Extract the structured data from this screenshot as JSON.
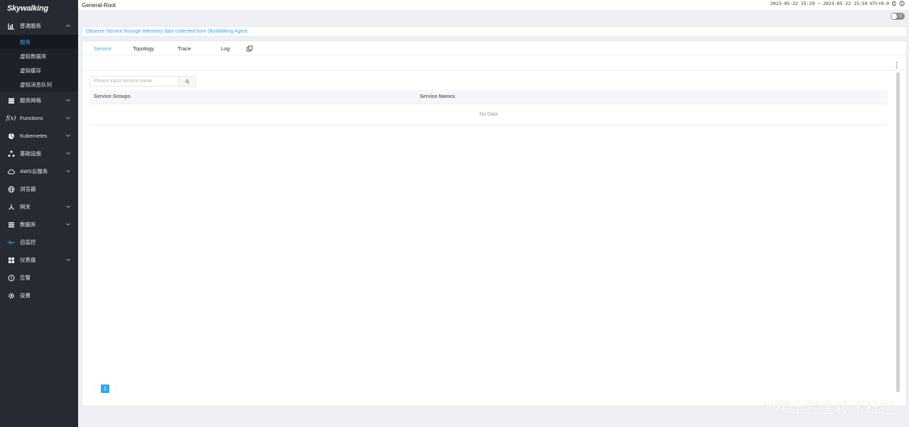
{
  "brand": {
    "logo_text": "Skywalking"
  },
  "colors": {
    "accent": "#3aa5ea",
    "sidebar_bg": "#252a33",
    "content_bg": "#eef0f3"
  },
  "sidebar": {
    "items": [
      {
        "label": "普通服务",
        "icon": "chart-bar-icon",
        "expanded": true,
        "children": [
          {
            "label": "服务",
            "active": true
          },
          {
            "label": "虚拟数据库"
          },
          {
            "label": "虚拟缓存"
          },
          {
            "label": "虚拟消息队列"
          }
        ]
      },
      {
        "label": "服务网格",
        "icon": "layers-icon"
      },
      {
        "label": "Functions",
        "icon": "function-icon"
      },
      {
        "label": "Kubernetes",
        "icon": "kubernetes-icon"
      },
      {
        "label": "基础设施",
        "icon": "nodes-icon"
      },
      {
        "label": "AWS云服务",
        "icon": "cloud-icon"
      },
      {
        "label": "浏览器",
        "icon": "globe-icon"
      },
      {
        "label": "网关",
        "icon": "gateway-icon"
      },
      {
        "label": "数据库",
        "icon": "database-icon"
      },
      {
        "label": "自监控",
        "icon": "self-monitor-icon"
      },
      {
        "label": "仪表盘",
        "icon": "dashboard-icon"
      },
      {
        "label": "告警",
        "icon": "alert-icon"
      },
      {
        "label": "设置",
        "icon": "gear-icon"
      }
    ]
  },
  "header": {
    "title": "General-Root",
    "time_range": "2023-05-22 15:29 ~ 2023-05-22 15:59",
    "timezone": "UTC+0.0",
    "toggle_label": "V"
  },
  "info": {
    "text": "Observe Service through telemetry data collected from SkyWalking Agent."
  },
  "tabs": [
    {
      "label": "Service",
      "active": true
    },
    {
      "label": "Topology"
    },
    {
      "label": "Trace"
    },
    {
      "label": "Log"
    }
  ],
  "search": {
    "placeholder": "Please input service name",
    "value": ""
  },
  "table": {
    "columns": [
      "Service Groups",
      "Service Names"
    ],
    "empty_text": "No Data"
  },
  "pagination": {
    "current_page": "1"
  },
  "watermark": "@稀土掘金技术社区"
}
